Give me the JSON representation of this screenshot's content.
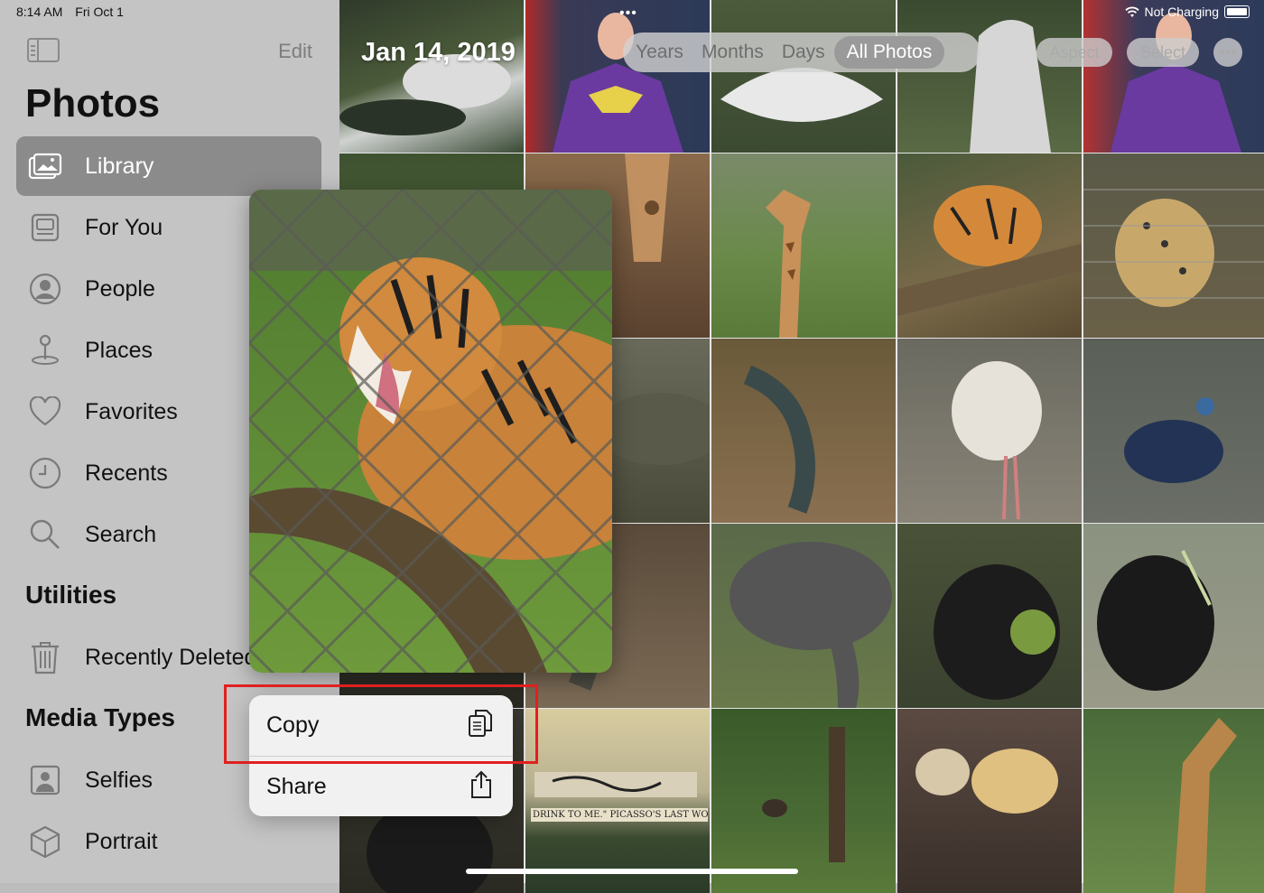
{
  "status_bar": {
    "time": "8:14 AM",
    "date": "Fri Oct 1",
    "battery_text": "Not Charging"
  },
  "sidebar": {
    "edit_label": "Edit",
    "title": "Photos",
    "items": [
      {
        "label": "Library",
        "icon": "photo-library-icon",
        "selected": true
      },
      {
        "label": "For You",
        "icon": "for-you-icon"
      },
      {
        "label": "People",
        "icon": "person-circle-icon"
      },
      {
        "label": "Places",
        "icon": "map-pin-icon"
      },
      {
        "label": "Favorites",
        "icon": "heart-icon"
      },
      {
        "label": "Recents",
        "icon": "clock-icon"
      },
      {
        "label": "Search",
        "icon": "search-icon"
      }
    ],
    "utilities_title": "Utilities",
    "utilities": [
      {
        "label": "Recently Deleted",
        "icon": "trash-icon"
      }
    ],
    "media_types_title": "Media Types",
    "media_types": [
      {
        "label": "Selfies",
        "icon": "selfie-icon"
      },
      {
        "label": "Portrait",
        "icon": "cube-icon"
      }
    ]
  },
  "library": {
    "date_label": "Jan 14, 2019",
    "segments": [
      "Years",
      "Months",
      "Days",
      "All Photos"
    ],
    "active_segment": "All Photos",
    "aspect_label": "Aspect",
    "select_label": "Select",
    "more_icon": "ellipsis-icon",
    "photos": [
      "dragon-statue",
      "batgirl-mannequin",
      "dragon-statue",
      "dragon-statue",
      "batgirl-mannequin",
      "giraffe-pen",
      "giraffe-closeup",
      "giraffe-field",
      "tiger-lying",
      "leopard-cage",
      "cage",
      "komodo-closeup",
      "komodo-dragon",
      "white-bird",
      "iridescent-pheasant",
      "gorilla",
      "lizard",
      "elephant",
      "gorilla-eating",
      "gorilla-sitting",
      "gorilla",
      "drink-to-me-painting",
      "ostrich-forest",
      "hamsters",
      "giraffe-trees"
    ]
  },
  "context_menu": {
    "preview": "tiger-roaring",
    "items": [
      {
        "label": "Copy",
        "icon": "copy-icon"
      },
      {
        "label": "Share",
        "icon": "share-icon"
      }
    ]
  },
  "painting_caption": "DRINK TO ME.\" PICASSO'S LAST WORDS",
  "colors": {
    "highlight": "#e02020",
    "sidebar": "#c4c4c4",
    "selected": "#8b8b8b"
  }
}
